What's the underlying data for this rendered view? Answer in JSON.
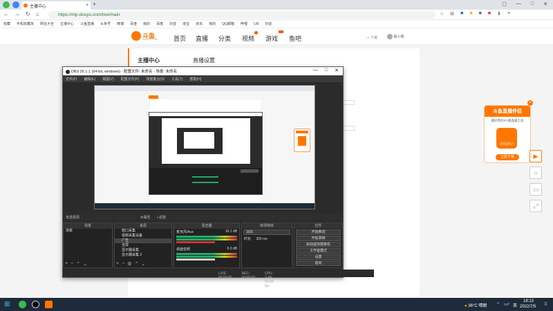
{
  "browser": {
    "tab_title": "主播中心",
    "tab_close": "×",
    "new_tab": "+",
    "url": "https://mp.douyu.com/live/main",
    "bookmarks": [
      "收藏",
      "手机收藏夹",
      "网址大全",
      "主播中心",
      "斗鱼直播",
      "头条号",
      "微博",
      "百度",
      "我的",
      "百度",
      "抖音",
      "淘宝",
      "京东",
      "我的",
      "QQ邮箱",
      "哔哩",
      "UR",
      "抖音"
    ]
  },
  "site": {
    "logo_text": "斗鱼",
    "logo_sub": "DOUYU.COM",
    "nav": [
      "首页",
      "直播",
      "分类",
      "视频",
      "游戏",
      "鱼吧"
    ],
    "download": "下载",
    "user": "鱼小萌"
  },
  "sidebar": {
    "title": "主播中心"
  },
  "content": {
    "title": "直播设置"
  },
  "obs": {
    "title": "OBS 26.1.1 (64-bit, windows) - 配置文件: 未命名 - 场景: 未命名",
    "menu": [
      "文件(F)",
      "编辑(E)",
      "视图(V)",
      "配置文件(P)",
      "场景集合(S)",
      "工具(T)",
      "帮助(H)"
    ],
    "no_source": "未选择源",
    "props_label": "属性",
    "filters_label": "滤镜",
    "docks": {
      "scenes": "场景",
      "sources": "来源",
      "mixer": "混音器",
      "transitions": "转场特效",
      "controls": "控件"
    },
    "scene_item": "场景",
    "sources_list": [
      "窗口采集",
      "视频采集设备",
      "广告",
      "全屏",
      "显示器采集",
      "显示器采集 2"
    ],
    "mixer_rows": [
      {
        "name": "麦克风/Aux",
        "level": "16.1 dB"
      },
      {
        "name": "桌面音频",
        "level": "0.0 dB"
      }
    ],
    "transition_value": "淡出",
    "duration_label": "时长",
    "duration_value": "300 ms",
    "controls": [
      "开始推流",
      "开始录制",
      "启动虚拟摄像机",
      "工作室模式",
      "设置",
      "退出"
    ],
    "status": [
      "LIVE: 00:00:00",
      "REC: 00:00:00",
      "CPU: 3.4%, 60.00 fps"
    ]
  },
  "promo": {
    "title": "斗鱼直播伴侣",
    "subtitle": "最好用的PC端直播工具",
    "button": "立即下载",
    "app_name": "DOUYU",
    "close": "×"
  },
  "taskbar": {
    "temp": "36°C 晴朗",
    "ime": "英",
    "time": "18:13",
    "date": "2022/7/5"
  },
  "colors": {
    "brand": "#ff7700",
    "obs_bg": "#2b2b2b",
    "taskbar": "#1e2b3a"
  }
}
